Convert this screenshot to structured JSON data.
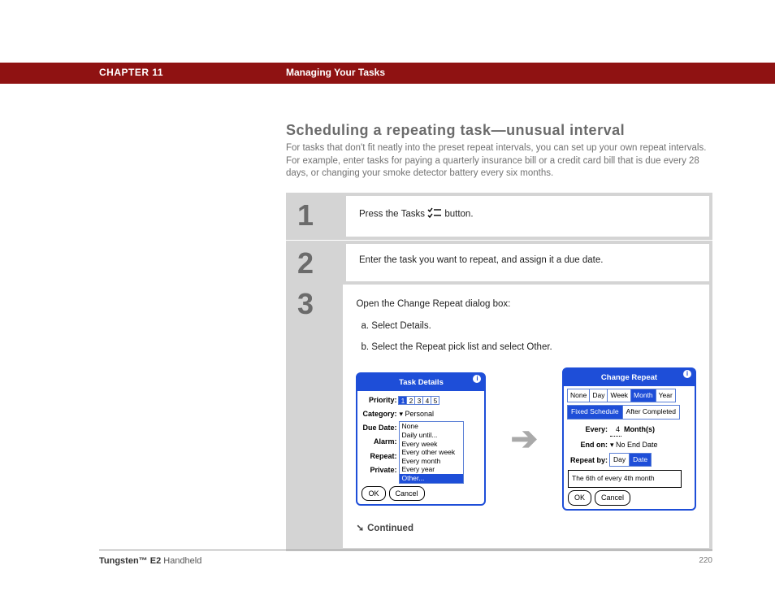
{
  "header": {
    "chapter": "CHAPTER 11",
    "title": "Managing Your Tasks"
  },
  "section": {
    "title": "Scheduling a repeating task—unusual interval",
    "intro": "For tasks that don't fit neatly into the preset repeat intervals, you can set up your own repeat intervals. For example, enter tasks for paying a quarterly insurance bill or a credit card bill that is due every 28 days, or changing your smoke detector battery every six months."
  },
  "steps": {
    "s1": {
      "num": "1",
      "pre": "Press the Tasks ",
      "post": " button."
    },
    "s2": {
      "num": "2",
      "text": "Enter the task you want to repeat, and assign it a due date."
    },
    "s3": {
      "num": "3",
      "lead": "Open the Change Repeat dialog box:",
      "a": "a.  Select Details.",
      "b": "b.  Select the Repeat pick list and select Other."
    }
  },
  "taskDetails": {
    "title": "Task Details",
    "priority_label": "Priority:",
    "priority": [
      "1",
      "2",
      "3",
      "4",
      "5"
    ],
    "category_label": "Category:",
    "category_value": "Personal",
    "duedate_label": "Due Date:",
    "alarm_label": "Alarm:",
    "repeat_label": "Repeat:",
    "private_label": "Private:",
    "options": [
      "None",
      "Daily until...",
      "Every week",
      "Every other week",
      "Every month",
      "Every year",
      "Other..."
    ],
    "ok": "OK",
    "cancel": "Cancel"
  },
  "changeRepeat": {
    "title": "Change Repeat",
    "tabs": [
      "None",
      "Day",
      "Week",
      "Month",
      "Year"
    ],
    "modes": [
      "Fixed Schedule",
      "After Completed"
    ],
    "every_label": "Every:",
    "every_value": "4",
    "every_unit": "Month(s)",
    "endon_label": "End on:",
    "endon_value": "No End Date",
    "repeatby_label": "Repeat by:",
    "repeatby_options": [
      "Day",
      "Date"
    ],
    "summary": "The 6th of every 4th month",
    "ok": "OK",
    "cancel": "Cancel"
  },
  "continued": "Continued",
  "footer": {
    "product_bold": "Tungsten™ E2",
    "product_rest": " Handheld",
    "page": "220"
  }
}
